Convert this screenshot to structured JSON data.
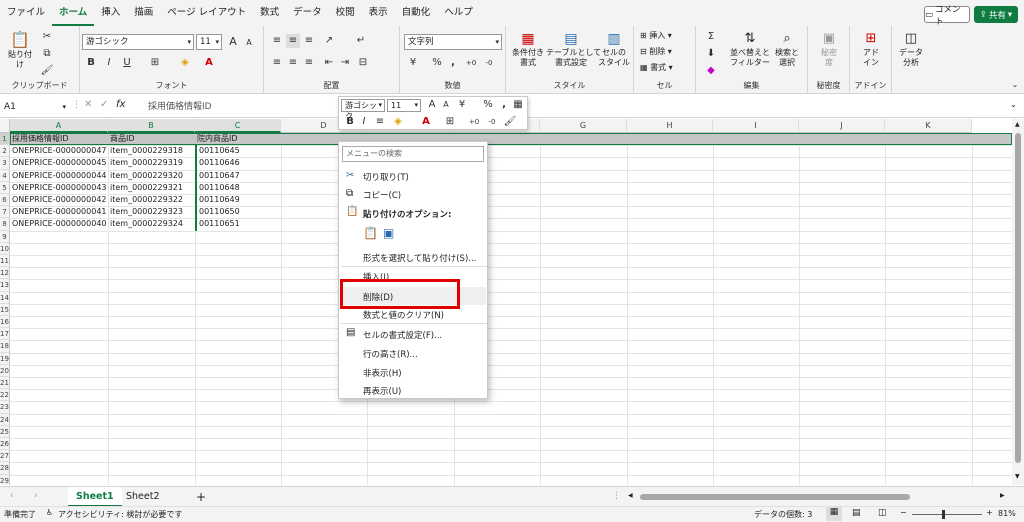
{
  "menu": {
    "tabs": [
      "ファイル",
      "ホーム",
      "挿入",
      "描画",
      "ページ レイアウト",
      "数式",
      "データ",
      "校閲",
      "表示",
      "自動化",
      "ヘルプ"
    ],
    "active": "ホーム",
    "comment_label": "コメント",
    "share_label": "共有"
  },
  "ribbon": {
    "clipboard": {
      "label": "クリップボード",
      "paste": "貼り付け"
    },
    "font": {
      "label": "フォント",
      "name": "游ゴシック",
      "size": "11",
      "bold": "B",
      "italic": "I",
      "underline": "U",
      "grow": "A",
      "shrink": "A"
    },
    "alignment": {
      "label": "配置"
    },
    "number": {
      "label": "数値",
      "format": "文字列",
      "percent": "%",
      "comma": ","
    },
    "styles": {
      "label": "スタイル",
      "conditional": "条件付き\n書式",
      "table": "テーブルとして\n書式設定",
      "cell": "セルの\nスタイル"
    },
    "cells": {
      "label": "セル",
      "insert": "挿入",
      "delete": "削除",
      "format": "書式"
    },
    "editing": {
      "label": "編集",
      "sort": "並べ替えと\nフィルター",
      "find": "検索と\n選択"
    },
    "sensitivity": {
      "label": "秘密度",
      "btn": "秘密\n度"
    },
    "addins": {
      "label": "アドイン",
      "btn": "アド\nイン"
    },
    "analysis": {
      "btn": "データ\n分析"
    }
  },
  "formula_bar": {
    "name_box": "A1",
    "fx": "fx",
    "value": "採用価格情報ID"
  },
  "mini_toolbar": {
    "font": "游ゴシック",
    "size": "11"
  },
  "columns": [
    "A",
    "B",
    "C",
    "D",
    "E",
    "F",
    "G",
    "H",
    "I",
    "J",
    "K"
  ],
  "rows": [
    "1",
    "2",
    "3",
    "4",
    "5",
    "6",
    "7",
    "8",
    "9",
    "10",
    "11",
    "12",
    "13",
    "14",
    "15",
    "16",
    "17",
    "18",
    "19",
    "20",
    "21",
    "22",
    "23",
    "24",
    "25",
    "26",
    "27",
    "28",
    "29"
  ],
  "table": {
    "headers": [
      "採用価格情報ID",
      "商品ID",
      "院内商品ID"
    ],
    "data": [
      [
        "ONEPRICE-0000000047",
        "item_0000229318",
        "00110645"
      ],
      [
        "ONEPRICE-0000000045",
        "item_0000229319",
        "00110646"
      ],
      [
        "ONEPRICE-0000000044",
        "item_0000229320",
        "00110647"
      ],
      [
        "ONEPRICE-0000000043",
        "item_0000229321",
        "00110648"
      ],
      [
        "ONEPRICE-0000000042",
        "item_0000229322",
        "00110649"
      ],
      [
        "ONEPRICE-0000000041",
        "item_0000229323",
        "00110650"
      ],
      [
        "ONEPRICE-0000000040",
        "item_0000229324",
        "00110651"
      ]
    ]
  },
  "context_menu": {
    "search_placeholder": "メニューの検索",
    "cut": "切り取り(T)",
    "copy": "コピー(C)",
    "paste_options": "貼り付けのオプション:",
    "paste_special": "形式を選択して貼り付け(S)...",
    "insert": "挿入(I)",
    "delete": "削除(D)",
    "clear": "数式と値のクリア(N)",
    "format_cells": "セルの書式設定(F)...",
    "row_height": "行の高さ(R)...",
    "hide": "非表示(H)",
    "unhide": "再表示(U)"
  },
  "sheets": [
    "Sheet1",
    "Sheet2"
  ],
  "add_sheet": "+",
  "status": {
    "ready": "準備完了",
    "accessibility": "アクセシビリティ: 検討が必要です",
    "count": "データの個数: 3",
    "zoom": "81%"
  },
  "colors": {
    "accent": "#107c41",
    "highlight": "#e00000"
  }
}
